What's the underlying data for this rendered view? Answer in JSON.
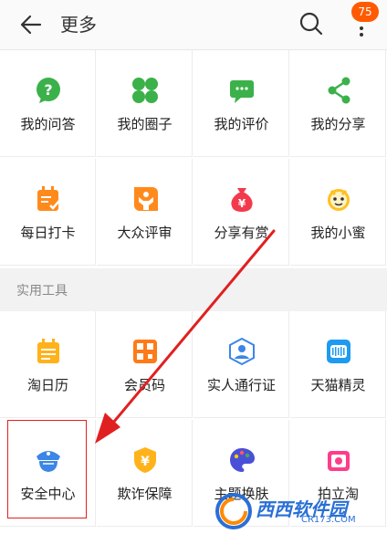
{
  "header": {
    "title": "更多",
    "badge_count": "75"
  },
  "section_title": "实用工具",
  "grid1": [
    {
      "label": "我的问答",
      "icon": "question-bubble-icon"
    },
    {
      "label": "我的圈子",
      "icon": "circle-group-icon"
    },
    {
      "label": "我的评价",
      "icon": "comment-icon"
    },
    {
      "label": "我的分享",
      "icon": "share-icon"
    },
    {
      "label": "每日打卡",
      "icon": "checkin-icon"
    },
    {
      "label": "大众评审",
      "icon": "review-icon"
    },
    {
      "label": "分享有赏",
      "icon": "money-bag-icon"
    },
    {
      "label": "我的小蜜",
      "icon": "assistant-icon"
    }
  ],
  "grid2": [
    {
      "label": "淘日历",
      "icon": "calendar-icon"
    },
    {
      "label": "会员码",
      "icon": "member-code-icon"
    },
    {
      "label": "实人通行证",
      "icon": "identity-icon"
    },
    {
      "label": "天猫精灵",
      "icon": "tmall-genie-icon"
    },
    {
      "label": "安全中心",
      "icon": "security-police-icon"
    },
    {
      "label": "欺诈保障",
      "icon": "fraud-shield-icon"
    },
    {
      "label": "主题换肤",
      "icon": "palette-icon"
    },
    {
      "label": "拍立淘",
      "icon": "camera-icon"
    }
  ],
  "watermark": {
    "text": "西西软件园",
    "sub": "CR173.COM"
  }
}
